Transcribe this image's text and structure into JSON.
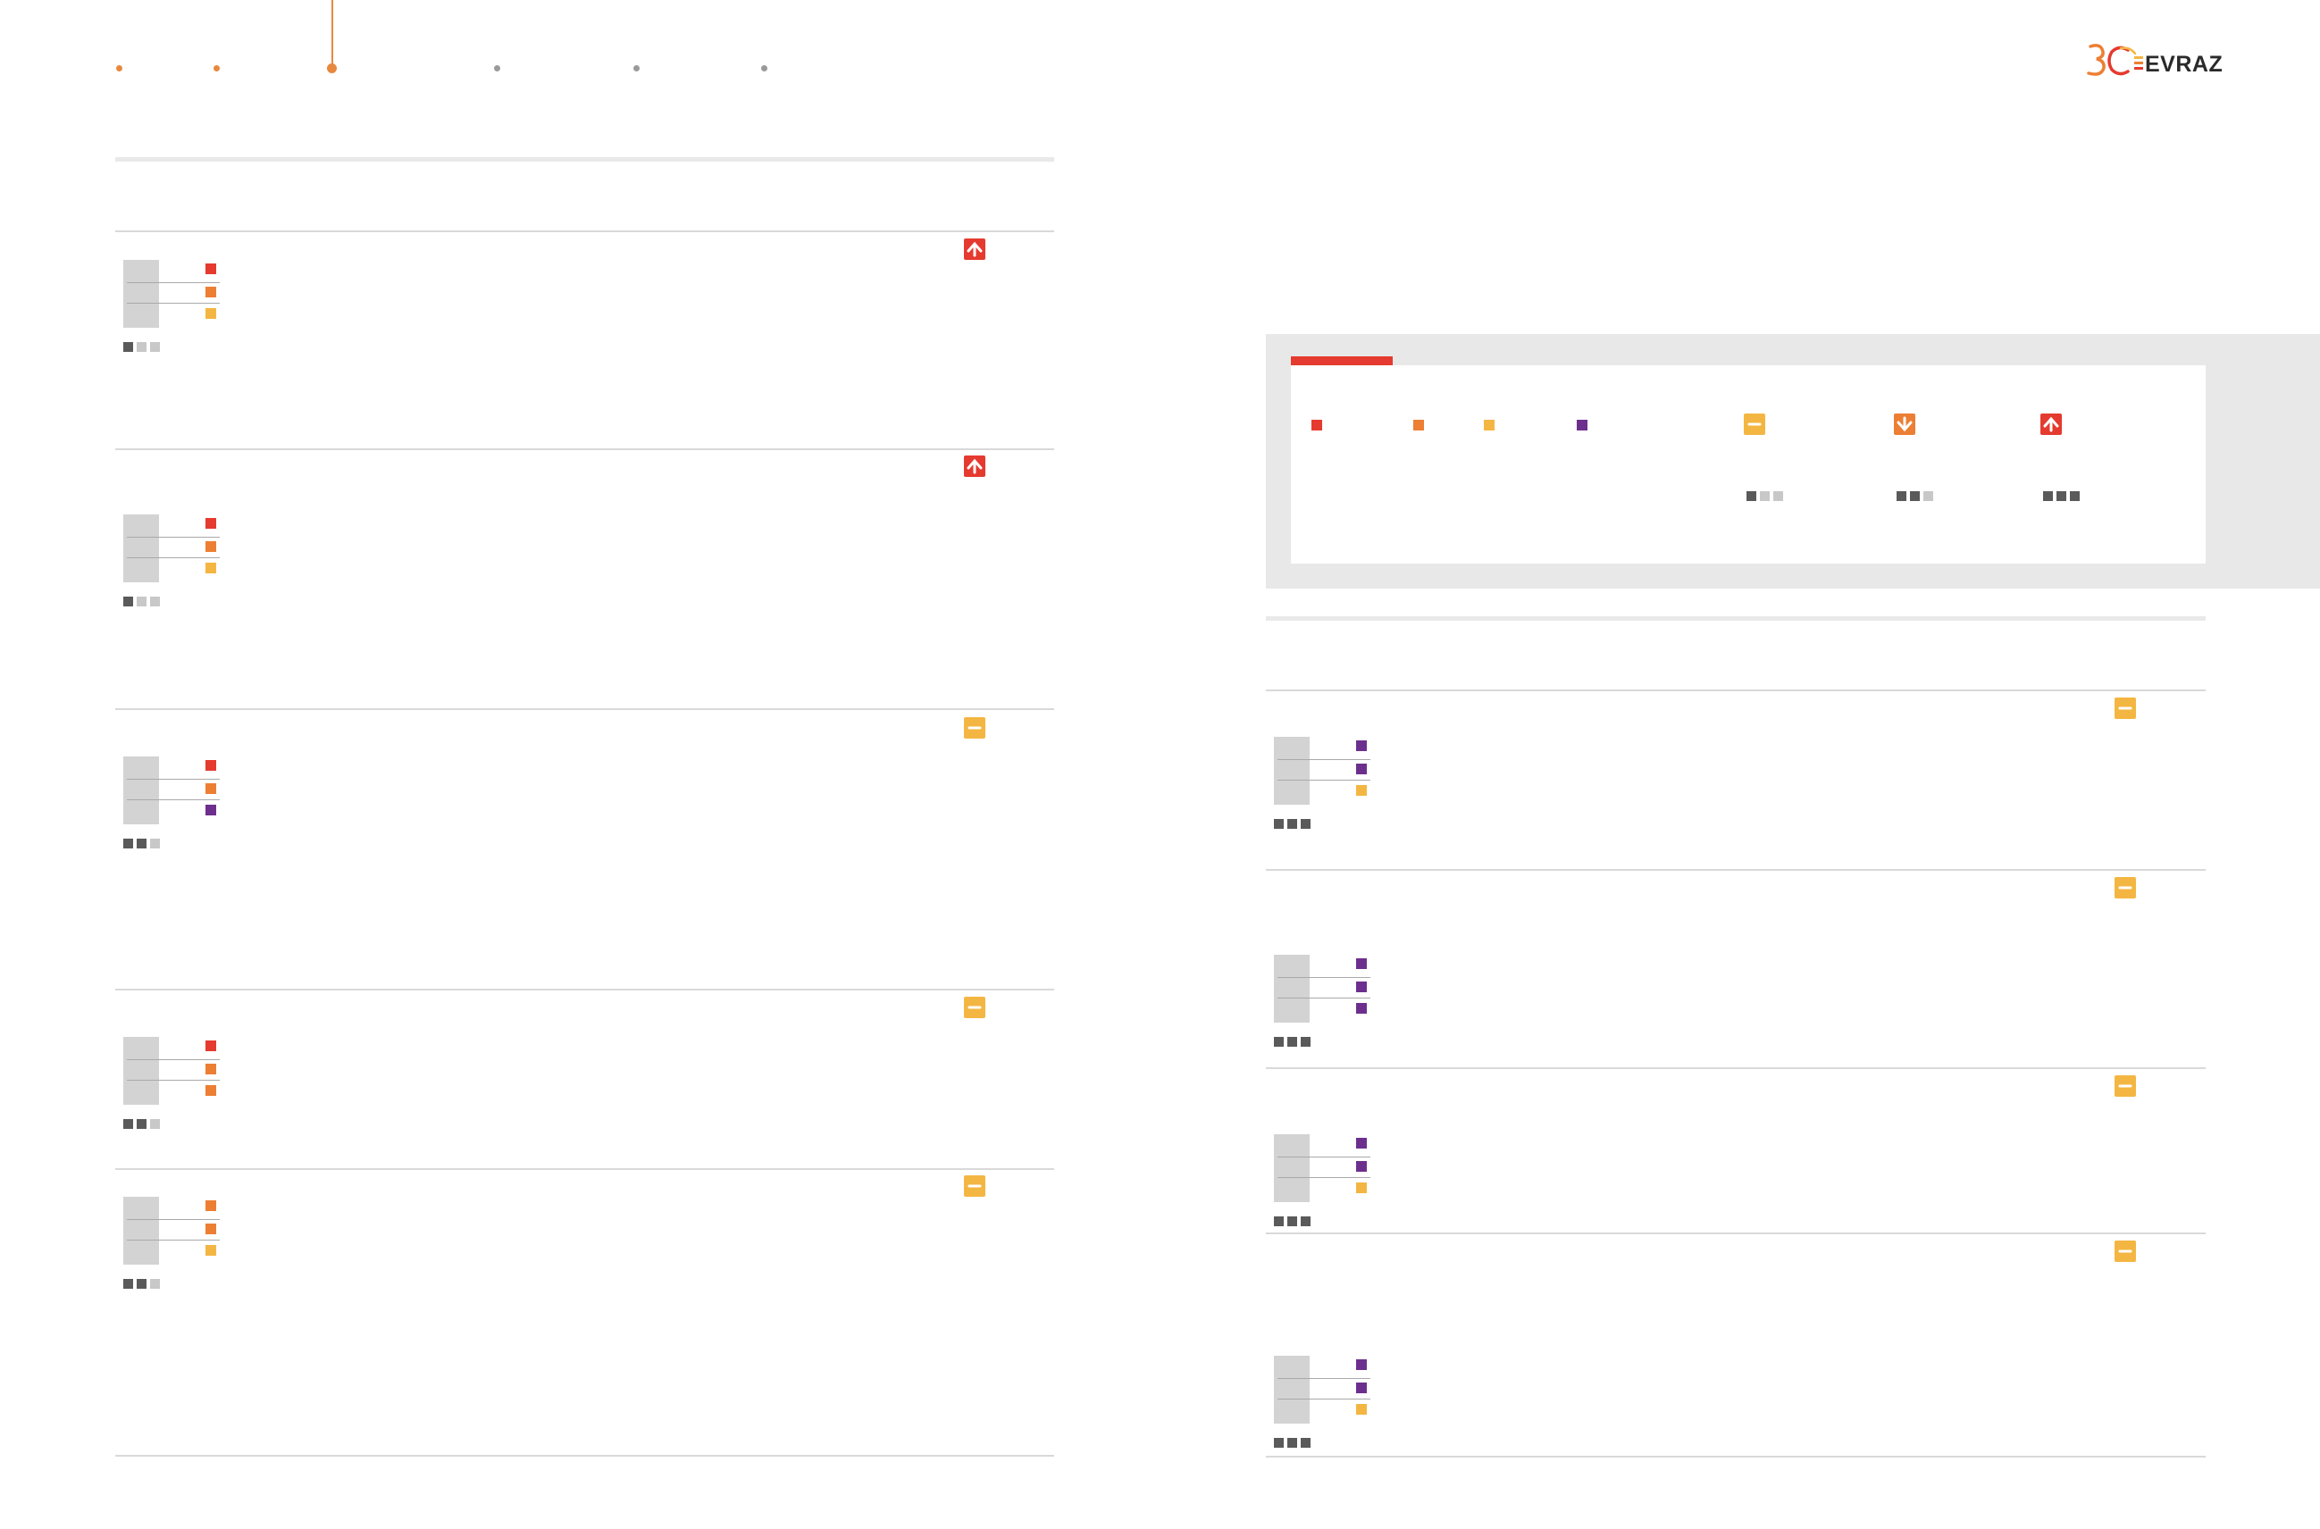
{
  "brand": {
    "logo_mark": "30",
    "logo_text": "EVRAZ",
    "colors": {
      "red": "#e53a2f",
      "orange": "#ec7f33",
      "yellow": "#f4b642",
      "purple": "#6d2f8e",
      "dark": "#5a5a5a",
      "light": "#c8c8c8",
      "matrix": "#d3d3d3"
    }
  },
  "nav": {
    "steps": [
      {
        "state": "done",
        "color": "#e8883e"
      },
      {
        "state": "done",
        "color": "#e8883e"
      },
      {
        "state": "current",
        "color": "#e8883e"
      },
      {
        "state": "upcoming",
        "color": "#9a9a9a"
      },
      {
        "state": "upcoming",
        "color": "#9a9a9a"
      },
      {
        "state": "upcoming",
        "color": "#9a9a9a"
      }
    ]
  },
  "legend": {
    "categories": [
      {
        "icon": "category-square",
        "color": "#e53a2f"
      },
      {
        "icon": "category-square",
        "color": "#ec7f33"
      },
      {
        "icon": "category-square",
        "color": "#f4b642"
      },
      {
        "icon": "category-square",
        "color": "#6d2f8e"
      }
    ],
    "trends": [
      {
        "icon": "trend-stable-icon",
        "color": "#f4b642",
        "level": 1
      },
      {
        "icon": "trend-decrease-icon",
        "color": "#ec7f33",
        "level": 2
      },
      {
        "icon": "trend-increase-icon",
        "color": "#e53a2f",
        "level": 3
      }
    ]
  },
  "left_risks": [
    {
      "squares": [
        "#e53a2f",
        "#ec7f33",
        "#f4b642"
      ],
      "level": 1,
      "trend": "increase"
    },
    {
      "squares": [
        "#e53a2f",
        "#ec7f33",
        "#f4b642"
      ],
      "level": 1,
      "trend": "increase"
    },
    {
      "squares": [
        "#e53a2f",
        "#ec7f33",
        "#6d2f8e"
      ],
      "level": 2,
      "trend": "stable"
    },
    {
      "squares": [
        "#e53a2f",
        "#ec7f33",
        "#ec7f33"
      ],
      "level": 2,
      "trend": "stable"
    },
    {
      "squares": [
        "#ec7f33",
        "#ec7f33",
        "#f4b642"
      ],
      "level": 2,
      "trend": "stable"
    }
  ],
  "right_risks": [
    {
      "squares": [
        "#6d2f8e",
        "#6d2f8e",
        "#f4b642"
      ],
      "level": 3,
      "trend": "stable"
    },
    {
      "squares": [
        "#6d2f8e",
        "#6d2f8e",
        "#6d2f8e"
      ],
      "level": 3,
      "trend": "stable"
    },
    {
      "squares": [
        "#6d2f8e",
        "#6d2f8e",
        "#f4b642"
      ],
      "level": 3,
      "trend": "stable"
    },
    {
      "squares": [
        "#6d2f8e",
        "#6d2f8e",
        "#f4b642"
      ],
      "level": 3,
      "trend": "stable"
    }
  ]
}
